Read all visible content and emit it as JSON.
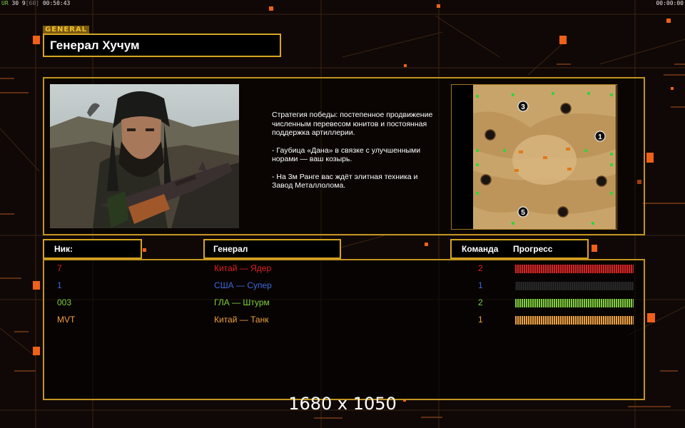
{
  "hud": {
    "left_prefix": "UR",
    "left_mid": "30 9",
    "left_fps": "[60]",
    "left_time": "00:50:43",
    "right_time": "00:00:00"
  },
  "general_label": "GENERAL",
  "general_name": "Генерал Хучум",
  "description": {
    "strategy": "Стратегия победы: постепенное продвижение численным перевесом юнитов и постоянная поддержка артиллерии.",
    "bullet1": "- Гаубица «Дана» в связке с улучшенными норами — ваш козырь.",
    "bullet2": "- На 3м Ранге вас ждёт элитная техника и Завод Металлолома."
  },
  "map_start_positions": [
    "3",
    "1",
    "5"
  ],
  "headers": {
    "nick": "Ник:",
    "general": "Генерал",
    "team": "Команда",
    "progress": "Прогресс"
  },
  "players": [
    {
      "nick": "7",
      "general": "Китай — Ядер",
      "team": "2",
      "progress": 1.0,
      "color": "#e02020"
    },
    {
      "nick": "1",
      "general": "США — Супер",
      "team": "1",
      "progress": 0.0,
      "color": "#3a6ad8"
    },
    {
      "nick": "003",
      "general": "ГЛА — Штурм",
      "team": "2",
      "progress": 1.0,
      "color": "#7fd03a"
    },
    {
      "nick": "MVT",
      "general": "Китай — Танк",
      "team": "1",
      "progress": 1.0,
      "color": "#f0a040"
    }
  ],
  "resolution": "1680 x 1050"
}
